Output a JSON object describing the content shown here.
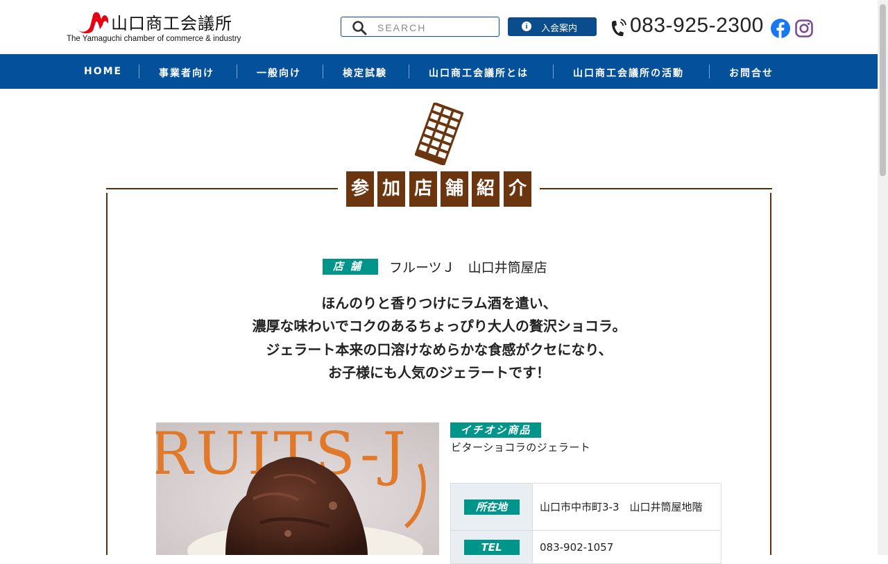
{
  "header": {
    "org_name": "山口商工会議所",
    "org_name_en": "The Yamaguchi chamber of commerce & industry",
    "search_placeholder": "SEARCH",
    "join_button": "入会案内",
    "phone": "083-925-2300",
    "social_icons": [
      "facebook-icon",
      "instagram-icon"
    ]
  },
  "nav": {
    "items": [
      "HOME",
      "事業者向け",
      "一般向け",
      "検定試験",
      "山口商工会議所とは",
      "山口商工会議所の活動",
      "お問合せ"
    ]
  },
  "section": {
    "title_chars": [
      "参",
      "加",
      "店",
      "舗",
      "紹",
      "介"
    ]
  },
  "shop": {
    "tag": "店舗",
    "name": "フルーツＪ　山口井筒屋店",
    "description": [
      "ほんのりと香りつけにラム酒を遣い、",
      "濃厚な味わいでコクのあるちょっぴり大人の贅沢ショコラ。",
      "ジェラート本来の口溶けなめらかな食感がクセになり、",
      "お子様にも人気のジェラートです！"
    ],
    "photo_text": "RUITS-J",
    "recommend_tag": "イチオシ商品",
    "recommend_name": "ビターショコラのジェラート",
    "info": [
      {
        "label": "所在地",
        "value": "山口市中市町3-3　山口井筒屋地階"
      },
      {
        "label": "TEL",
        "value": "083-902-1057"
      }
    ]
  },
  "colors": {
    "brand_blue": "#05509a",
    "chocolate": "#6b350f",
    "teal": "#00958b",
    "logo_red": "#e60012"
  }
}
